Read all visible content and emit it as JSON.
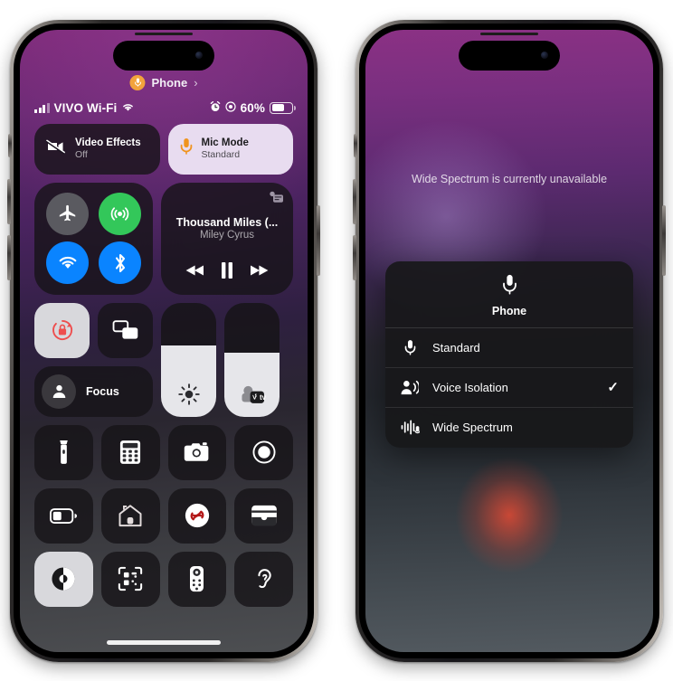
{
  "left_phone": {
    "header": {
      "app_label": "Phone",
      "chevron": "›",
      "badge_icon": "mic-icon"
    },
    "status_bar": {
      "carrier": "VIVO Wi-Fi",
      "signal_icon": "cellular-bars-icon",
      "wifi_icon": "wifi-icon",
      "alarm_icon": "alarm-icon",
      "location_icon": "location-icon",
      "battery_percent": "60%",
      "battery_icon": "battery-icon",
      "battery_level": 55
    },
    "effects": [
      {
        "name": "video-effects",
        "title": "Video Effects",
        "subtitle": "Off",
        "icon": "video-off-icon",
        "active": false
      },
      {
        "name": "mic-mode",
        "title": "Mic Mode",
        "subtitle": "Standard",
        "icon": "mic-icon",
        "active": true
      }
    ],
    "connectivity": [
      {
        "name": "airplane-mode",
        "icon": "airplane-icon",
        "color": "#5a5a60",
        "on": false
      },
      {
        "name": "cellular-data",
        "icon": "cellular-signal-icon",
        "color": "#33c75a",
        "on": true
      },
      {
        "name": "wifi-toggle",
        "icon": "wifi-icon",
        "color": "#0a84ff",
        "on": true
      },
      {
        "name": "bluetooth-toggle",
        "icon": "bluetooth-icon",
        "color": "#0a84ff",
        "on": true
      }
    ],
    "media": {
      "title": "Thousand Miles (...",
      "artist": "Miley Cyrus",
      "airplay_icon": "airplay-icon",
      "controls": [
        {
          "name": "rewind-button",
          "icon": "rewind-icon"
        },
        {
          "name": "pause-button",
          "icon": "pause-icon"
        },
        {
          "name": "forward-button",
          "icon": "forward-icon"
        }
      ]
    },
    "mid_controls": [
      {
        "name": "rotation-lock",
        "icon": "rotation-lock-icon",
        "active": true
      },
      {
        "name": "screen-mirroring",
        "icon": "screen-mirroring-icon",
        "active": false
      }
    ],
    "focus": {
      "label": "Focus",
      "icon": "person-icon"
    },
    "sliders": [
      {
        "name": "brightness-slider",
        "icon": "brightness-icon",
        "level": 62
      },
      {
        "name": "volume-slider",
        "icon": "appletv-volume-icon",
        "level": 56
      }
    ],
    "icon_grid": [
      {
        "name": "flashlight-button",
        "icon": "flashlight-icon",
        "active": false
      },
      {
        "name": "calculator-button",
        "icon": "calculator-icon",
        "active": false
      },
      {
        "name": "camera-button",
        "icon": "camera-icon",
        "active": false
      },
      {
        "name": "screen-record-button",
        "icon": "record-icon",
        "active": false
      },
      {
        "name": "low-power-mode-button",
        "icon": "low-battery-icon",
        "active": false
      },
      {
        "name": "home-button",
        "icon": "home-icon",
        "active": false
      },
      {
        "name": "shazam-button",
        "icon": "shazam-icon",
        "active": false
      },
      {
        "name": "wallet-button",
        "icon": "wallet-icon",
        "active": false
      },
      {
        "name": "dark-mode-button",
        "icon": "dark-mode-icon",
        "active": true
      },
      {
        "name": "qr-scanner-button",
        "icon": "qr-code-icon",
        "active": false
      },
      {
        "name": "apple-tv-remote-button",
        "icon": "remote-icon",
        "active": false
      },
      {
        "name": "hearing-button",
        "icon": "ear-icon",
        "active": false
      }
    ]
  },
  "right_phone": {
    "notice": "Wide Spectrum is currently unavailable",
    "dialog": {
      "title": "Phone",
      "header_icon": "mic-icon",
      "options": [
        {
          "name": "mic-mode-standard",
          "label": "Standard",
          "icon": "mic-icon",
          "selected": false,
          "check": ""
        },
        {
          "name": "mic-mode-voice-isolation",
          "label": "Voice Isolation",
          "icon": "voice-isolation-icon",
          "selected": true,
          "check": "✓"
        },
        {
          "name": "mic-mode-wide-spectrum",
          "label": "Wide Spectrum",
          "icon": "wide-spectrum-icon",
          "selected": false,
          "check": ""
        }
      ]
    }
  },
  "colors": {
    "accent_orange": "#f2a33c",
    "green": "#33c75a",
    "blue": "#0a84ff",
    "red": "#ff3b30",
    "active_tile": "#d8d8dc"
  }
}
